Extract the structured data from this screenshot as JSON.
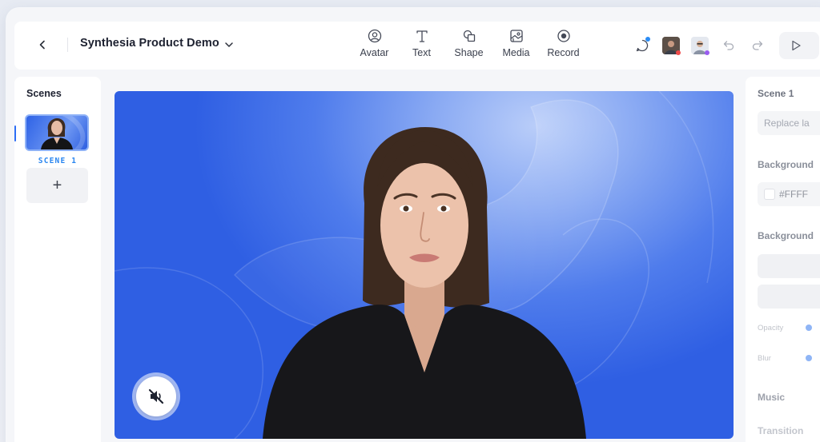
{
  "header": {
    "project_title": "Synthesia Product Demo",
    "tools": [
      {
        "label": "Avatar",
        "icon": "avatar-icon"
      },
      {
        "label": "Text",
        "icon": "text-icon"
      },
      {
        "label": "Shape",
        "icon": "shape-icon"
      },
      {
        "label": "Media",
        "icon": "media-icon"
      },
      {
        "label": "Record",
        "icon": "record-icon"
      }
    ],
    "right_icons": [
      "comment-icon",
      "user-avatar-1",
      "user-avatar-2",
      "undo-icon",
      "redo-icon",
      "play-icon"
    ]
  },
  "scenes_panel": {
    "title": "Scenes",
    "scenes": [
      {
        "label": "SCENE 1",
        "selected": true
      }
    ],
    "add_label": "+"
  },
  "canvas": {
    "muted": true
  },
  "properties_panel": {
    "title": "Scene 1",
    "layout_placeholder": "Replace la",
    "background_color_label": "Background",
    "background_color_value": "#FFFF",
    "background_media_label": "Background",
    "opacity_label": "Opacity",
    "blur_label": "Blur",
    "music_label": "Music",
    "transition_label": "Transition"
  },
  "colors": {
    "accent": "#2d6ef5",
    "scene_label": "#2a86f0",
    "canvas_blue": "#2f5fe3"
  }
}
